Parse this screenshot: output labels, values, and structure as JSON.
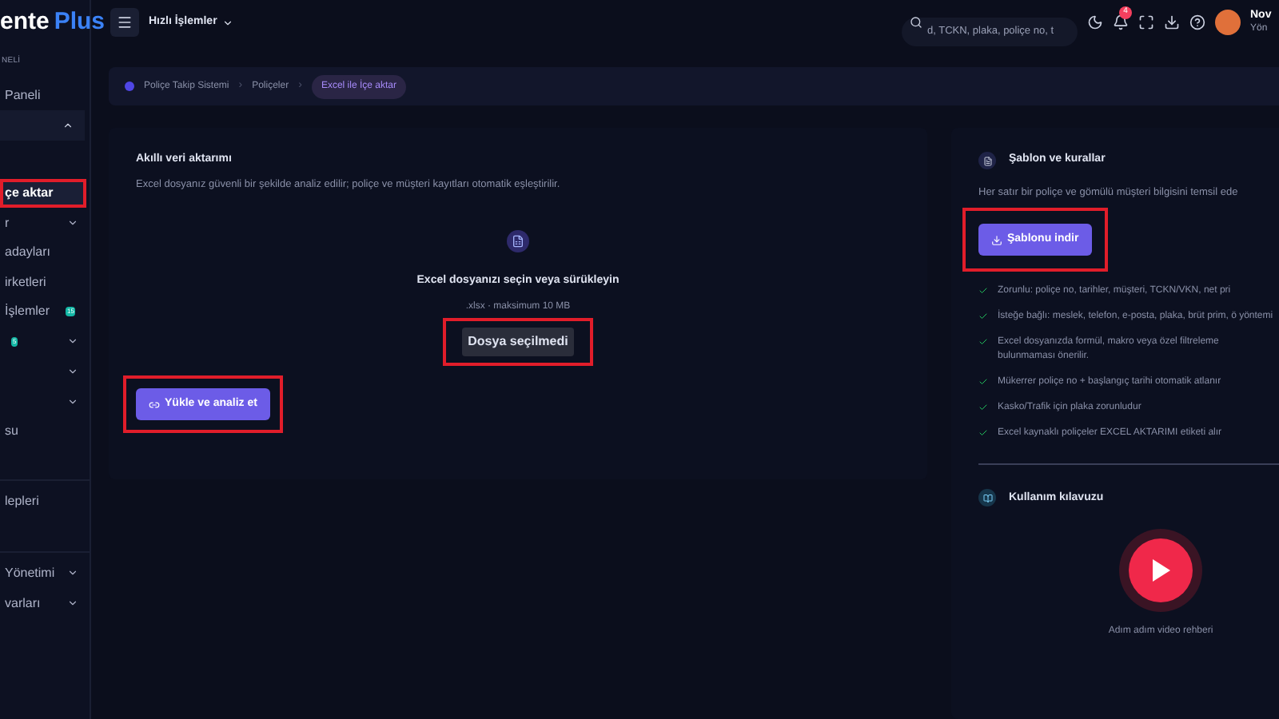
{
  "logo": {
    "text": "ente",
    "accent": "Plus"
  },
  "sidebar": {
    "section": "NELİ",
    "groups": [
      {
        "items": [
          {
            "label": "Paneli",
            "selected": false
          },
          {
            "selected": false,
            "expanded": true,
            "shaded": true
          },
          {
            "label": "çe aktar",
            "selected": true,
            "framed": true
          },
          {
            "label": "r",
            "selected": false,
            "expanded": false
          },
          {
            "label": "adayları",
            "selected": false
          },
          {
            "label": "irketleri",
            "selected": false
          },
          {
            "label": "İşlemler",
            "selected": false,
            "badge": "15"
          },
          {
            "selected": false,
            "expanded": false,
            "badge": "5"
          },
          {
            "selected": false,
            "expanded": false
          },
          {
            "selected": false,
            "expanded": false
          },
          {
            "label": "su",
            "selected": false
          }
        ]
      },
      {
        "items": [
          {
            "label": "lepleri",
            "selected": false
          }
        ]
      },
      {
        "items": [
          {
            "label": "Yönetimi",
            "selected": false,
            "expanded": false
          },
          {
            "label": "varları",
            "selected": false,
            "expanded": false
          }
        ]
      }
    ]
  },
  "topbar": {
    "quick_actions": "Hızlı İşlemler",
    "search": {
      "value": "d, TCKN, plaka, poliçe no, t"
    },
    "notifications": "4",
    "user": {
      "name": "Nov",
      "role": "Yön"
    }
  },
  "breadcrumb": [
    {
      "label": "Poliçe Takip Sistemi",
      "selected": false,
      "separator": "›"
    },
    {
      "label": "Poliçeler",
      "selected": false,
      "separator": "›"
    },
    {
      "label": "Excel ile İçe aktar",
      "selected": true
    }
  ],
  "upload_card": {
    "title": "Akıllı veri aktarımı",
    "description": "Excel dosyanız güvenli bir şekilde analiz edilir; poliçe ve müşteri kayıtları otomatik eşleştirilir.",
    "drop_title": "Excel dosyanızı seçin veya sürükleyin",
    "drop_hint": ".xlsx · maksimum 10 MB",
    "file_status": "Dosya seçilmedi",
    "file_status_framed": true,
    "submit": "Yükle ve analiz et",
    "submit_framed": true
  },
  "template_card": {
    "title": "Şablon ve kurallar",
    "description": "Her satır bir poliçe ve gömülü müşteri bilgisini temsil ede",
    "download": "Şablonu indir",
    "download_framed": true,
    "rules": [
      "Zorunlu: poliçe no, tarihler, müşteri, TCKN/VKN, net pri",
      "İsteğe bağlı: meslek, telefon, e-posta, plaka, brüt prim, ö yöntemi",
      "Excel dosyanızda formül, makro veya özel filtreleme bulunmaması önerilir.",
      "Mükerrer poliçe no + başlangıç tarihi otomatik atlanır",
      "Kasko/Trafik için plaka zorunludur",
      "Excel kaynaklı poliçeler EXCEL AKTARIMI etiketi alır"
    ],
    "guide_title": "Kullanım kılavuzu",
    "video_caption": "Adım adım video rehberi"
  }
}
